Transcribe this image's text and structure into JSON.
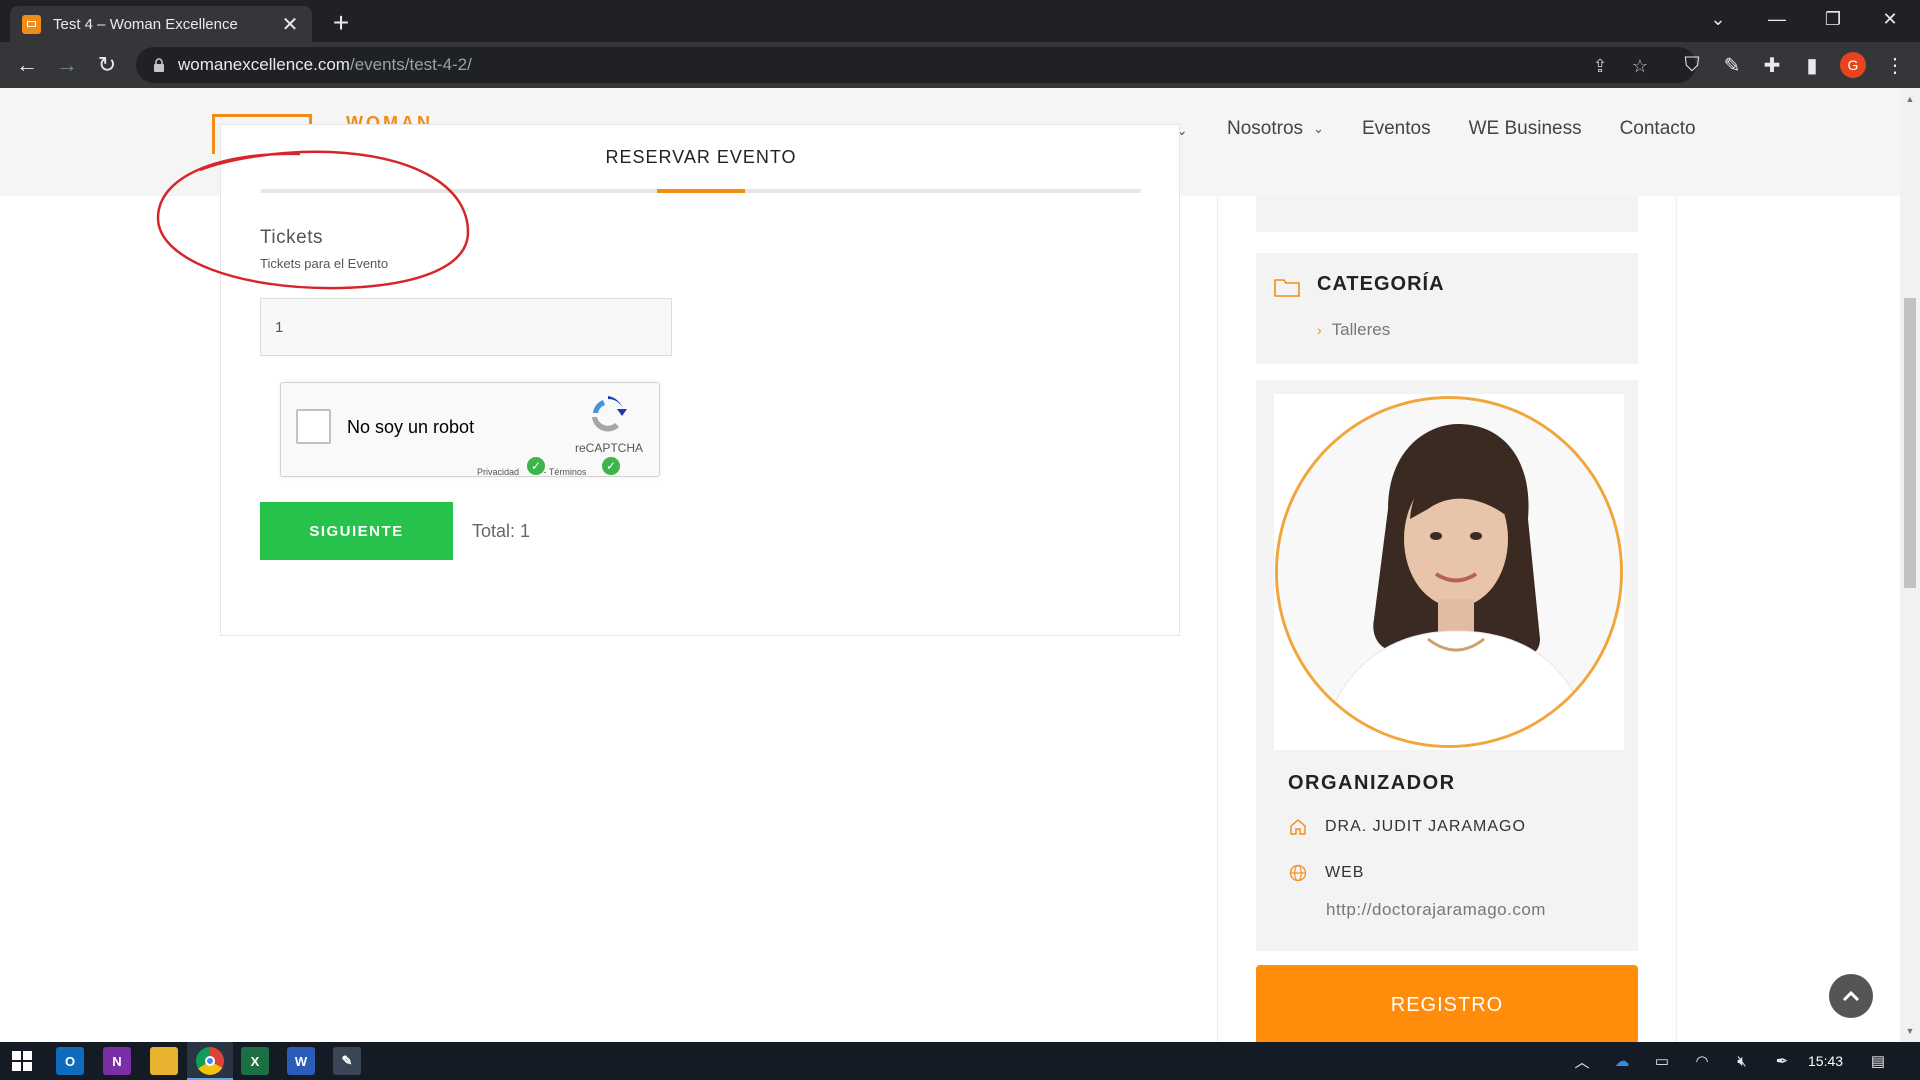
{
  "browser": {
    "tab_title": "Test 4 – Woman Excellence",
    "url_host": "womanexcellence.com",
    "url_path": "/events/test-4-2/"
  },
  "site": {
    "logo_text": "WOMAN",
    "nav": [
      "Nosotros",
      "Eventos",
      "WE Business",
      "Contacto"
    ]
  },
  "booking": {
    "title": "RESERVAR EVENTO",
    "tickets_heading": "Tickets",
    "tickets_sub": "Tickets para el Evento",
    "ticket_qty": "1",
    "recaptcha_label": "No soy un robot",
    "recaptcha_brand": "reCAPTCHA",
    "recaptcha_privacy": "Privacidad",
    "recaptcha_terms": "Términos",
    "next_button": "SIGUIENTE",
    "total": "Total: 1"
  },
  "sidebar": {
    "category_title": "CATEGORÍA",
    "category_item": "Talleres",
    "organizer_title": "ORGANIZADOR",
    "organizer_name": "DRA. JUDIT JARAMAGO",
    "web_label": "WEB",
    "web_url": "http://doctorajaramago.com",
    "register_button": "REGISTRO"
  },
  "taskbar": {
    "clock": "15:43",
    "apps": [
      "outlook-icon",
      "onenote-icon",
      "file-explorer-icon",
      "chrome-icon",
      "excel-icon",
      "word-icon",
      "misc-app-icon"
    ]
  },
  "colors": {
    "accent_orange": "#f28c18",
    "button_green": "#27c24c",
    "register_orange": "#ff8c0a",
    "annotation_red": "#d6262b"
  }
}
